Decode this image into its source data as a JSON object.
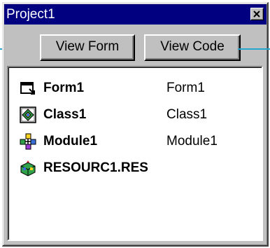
{
  "window": {
    "title": "Project1",
    "close_icon": "close-icon"
  },
  "toolbar": {
    "view_form_label": "View Form",
    "view_code_label": "View Code"
  },
  "tree": {
    "items": [
      {
        "name": "Form1",
        "file": "Form1",
        "icon": "form-icon"
      },
      {
        "name": "Class1",
        "file": "Class1",
        "icon": "class-module-icon"
      },
      {
        "name": "Module1",
        "file": "Module1",
        "icon": "module-icon"
      },
      {
        "name": "RESOURC1.RES",
        "file": "",
        "icon": "resource-file-icon"
      }
    ]
  },
  "colors": {
    "titlebar": "#000080",
    "face": "#c0c0c0",
    "callout": "#26a6cf"
  }
}
